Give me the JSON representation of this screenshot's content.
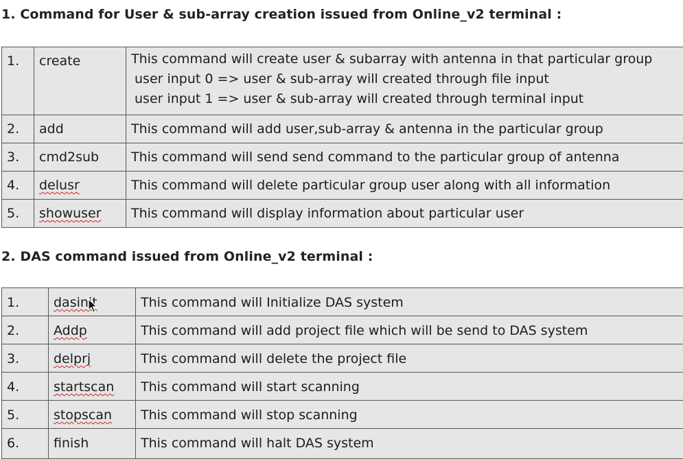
{
  "section1": {
    "heading": "1. Command for User & sub-array creation issued from Online_v2 terminal :",
    "rows": [
      {
        "num": "1.",
        "cmd": "create",
        "desc": [
          "This command will create user & subarray with antenna in that particular group",
          "user input 0 => user & sub-array will created through file input",
          "user input 1 => user & sub-array will created through terminal input"
        ]
      },
      {
        "num": "2.",
        "cmd": "add",
        "desc": "This command will add user,sub-array & antenna in the particular group"
      },
      {
        "num": "3.",
        "cmd": "cmd2sub",
        "desc": "This command will send send command to the particular group of antenna"
      },
      {
        "num": "4.",
        "cmd": "delusr",
        "desc": "This command will delete particular group user along with all information"
      },
      {
        "num": "5.",
        "cmd": "showuser",
        "desc": "This command will display information about particular user"
      }
    ]
  },
  "section2": {
    "heading": "2. DAS command issued from Online_v2 terminal  :",
    "rows": [
      {
        "num": "1.",
        "cmd": "dasinit",
        "desc": "This command will Initialize DAS system"
      },
      {
        "num": "2.",
        "cmd": "Addp",
        "desc": "This command will add project file which will be send to DAS system"
      },
      {
        "num": "3.",
        "cmd": "delprj",
        "desc": "This command will delete the project file"
      },
      {
        "num": "4.",
        "cmd": "startscan",
        "desc": "This command will start scanning"
      },
      {
        "num": "5.",
        "cmd": "stopscan",
        "desc": "This command will stop scanning"
      },
      {
        "num": "6.",
        "cmd": "finish",
        "desc": "This command will halt DAS system"
      }
    ]
  },
  "spellcheck_color": "#d42020",
  "cell_background": "#e6e6e6",
  "cursor_icon": "mouse-pointer-icon"
}
